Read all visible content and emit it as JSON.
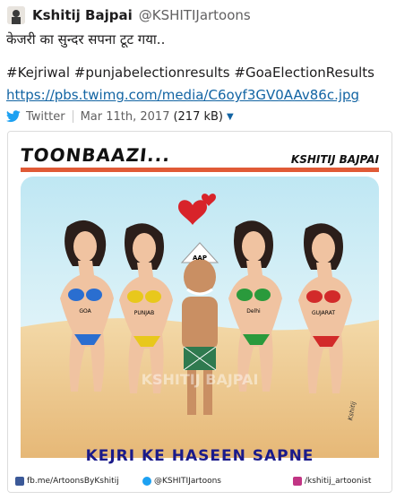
{
  "message": {
    "author": "Kshitij Bajpai",
    "handle": "@KSHITIJartoons",
    "text_line1": "केजरी का सुन्दर सपना टूट गया..",
    "text_line2": "#Kejriwal #punjabelectionresults #GoaElectionResults",
    "link": "https://pbs.twimg.com/media/C6oyf3GV0AAv86c.jpg"
  },
  "meta": {
    "source": "Twitter",
    "date": "Mar 11th, 2017",
    "size": "(217 kB)"
  },
  "cartoon": {
    "brand": "TOONBAAZI...",
    "artist": "KSHITIJ BAJPAI",
    "hat": "AAP",
    "labels": [
      "GOA",
      "PUNJAB",
      "Delhi",
      "GUJARAT"
    ],
    "watermark": "KSHITIJ BAJPAI",
    "signature": "Kshitij",
    "caption": "KEJRI KE HASEEN SAPNE",
    "footer": {
      "facebook": "fb.me/ArtoonsByKshitij",
      "twitter": "@KSHITIJartoons",
      "instagram": "/kshitij_artoonist"
    }
  },
  "colors": {
    "link": "#1264a3",
    "twitter": "#1da1f2",
    "accent_bar": "#e05a36",
    "bikini_goa": "#2a6ed0",
    "bikini_punjab": "#e8c81c",
    "bikini_delhi": "#2a9a3c",
    "bikini_gujarat": "#d22a2a"
  }
}
